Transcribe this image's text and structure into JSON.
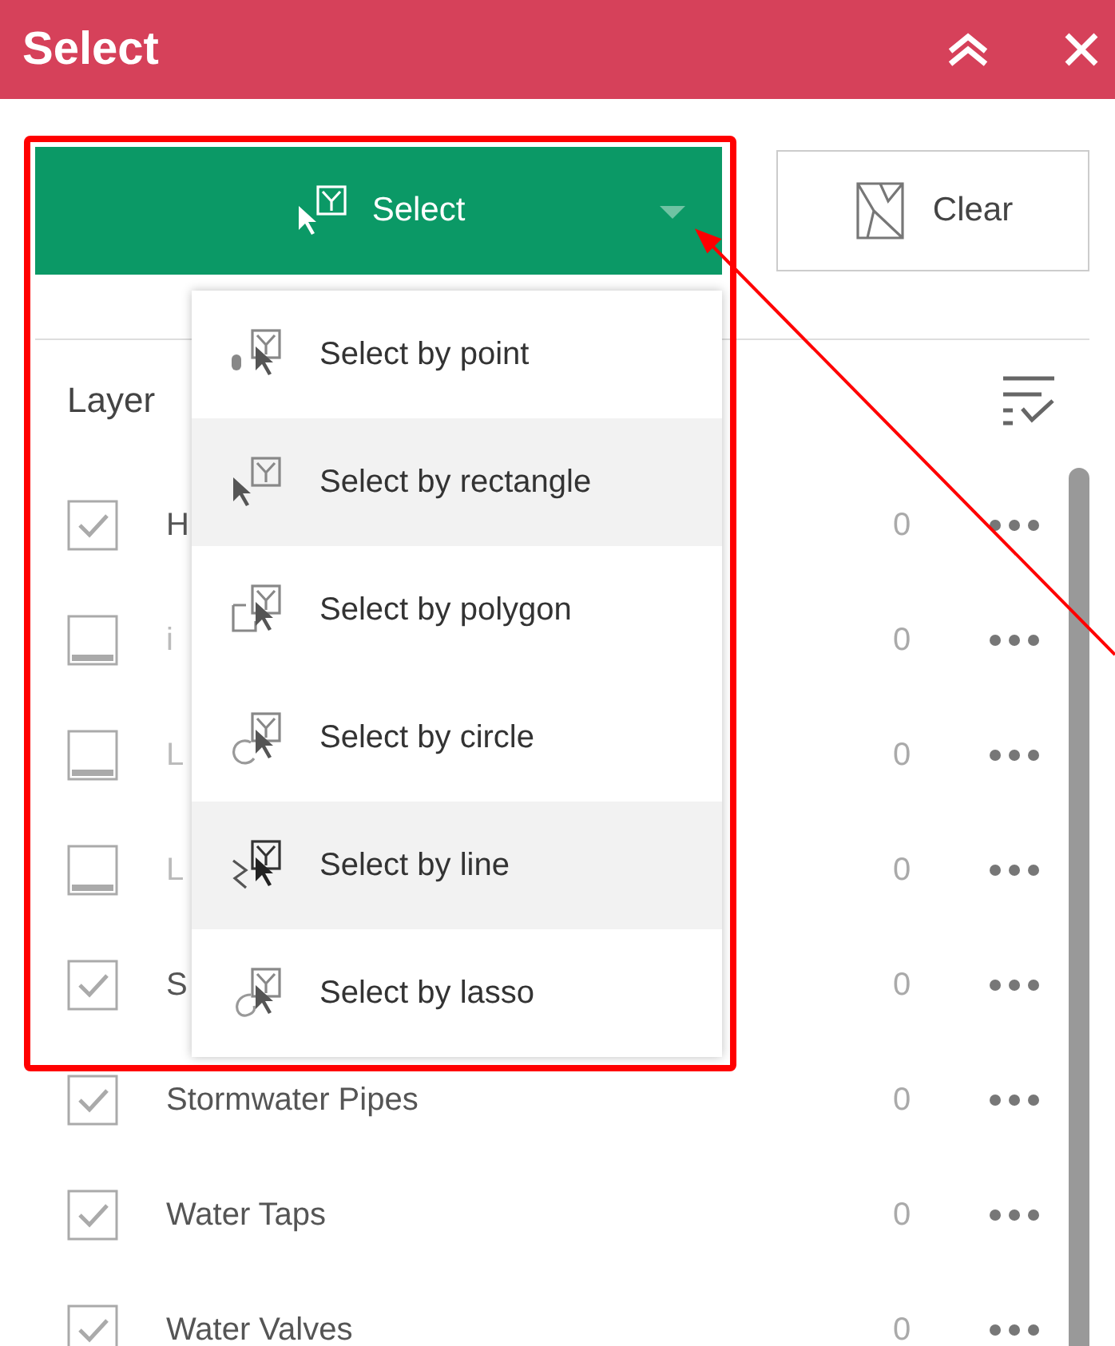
{
  "window": {
    "title": "Select"
  },
  "select_button": {
    "label": "Select"
  },
  "clear_button": {
    "label": "Clear"
  },
  "layer_header": {
    "label": "Layer"
  },
  "select_menu": {
    "items": [
      {
        "label": "Select by point",
        "kind": "point",
        "highlighted": false
      },
      {
        "label": "Select by rectangle",
        "kind": "rectangle",
        "highlighted": true
      },
      {
        "label": "Select by polygon",
        "kind": "polygon",
        "highlighted": false
      },
      {
        "label": "Select by circle",
        "kind": "circle",
        "highlighted": false
      },
      {
        "label": "Select by line",
        "kind": "line",
        "highlighted": true
      },
      {
        "label": "Select by lasso",
        "kind": "lasso",
        "highlighted": false
      }
    ]
  },
  "layers": [
    {
      "name": "H",
      "checked": true,
      "disabled": false,
      "count": "0"
    },
    {
      "name": "i",
      "checked": false,
      "disabled": true,
      "count": "0"
    },
    {
      "name": "L",
      "checked": false,
      "disabled": true,
      "count": "0"
    },
    {
      "name": "L",
      "checked": false,
      "disabled": true,
      "count": "0"
    },
    {
      "name": "S",
      "checked": true,
      "disabled": false,
      "count": "0"
    },
    {
      "name": "Stormwater Pipes",
      "checked": true,
      "disabled": false,
      "count": "0"
    },
    {
      "name": "Water Taps",
      "checked": true,
      "disabled": false,
      "count": "0"
    },
    {
      "name": "Water Valves",
      "checked": true,
      "disabled": false,
      "count": "0"
    }
  ]
}
